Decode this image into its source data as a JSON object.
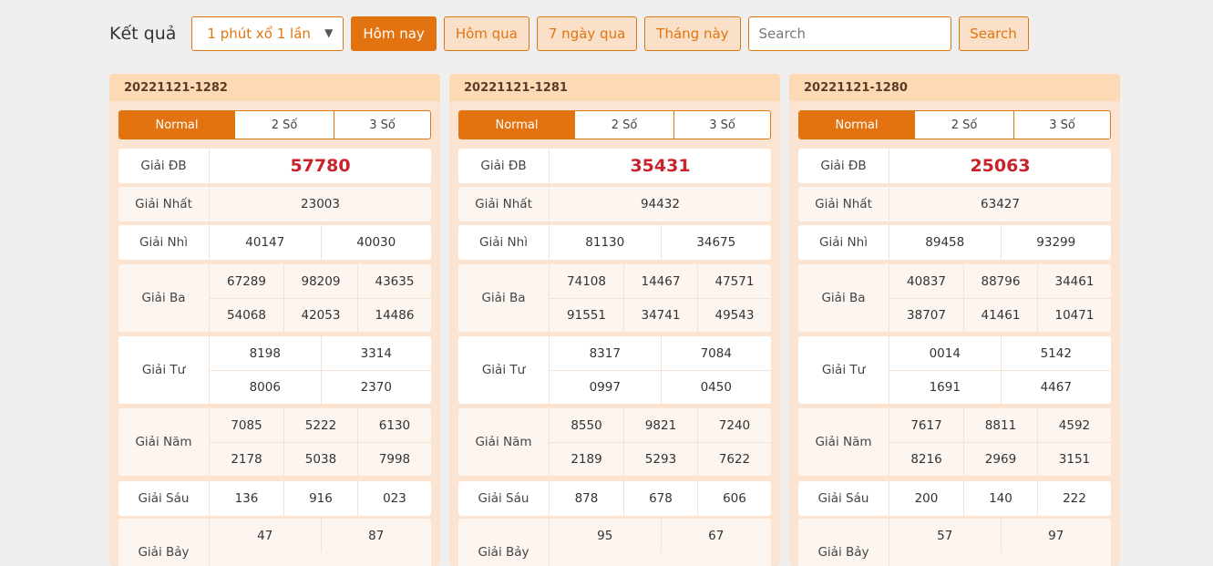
{
  "toolbar": {
    "label": "Kết quả",
    "select_value": "1 phút xổ 1 lần",
    "buttons": [
      "Hôm nay",
      "Hôm qua",
      "7 ngày qua",
      "Tháng này"
    ],
    "active_button": 0,
    "search_placeholder": "Search",
    "search_button": "Search"
  },
  "prize_labels": [
    "Giải ĐB",
    "Giải Nhất",
    "Giải Nhì",
    "Giải Ba",
    "Giải Tư",
    "Giải Năm",
    "Giải Sáu",
    "Giải Bảy"
  ],
  "tab_labels": [
    "Normal",
    "2 Số",
    "3 Số"
  ],
  "results": [
    {
      "id": "20221121-1282",
      "prizes": [
        [
          "57780"
        ],
        [
          "23003"
        ],
        [
          "40147",
          "40030"
        ],
        [
          "67289",
          "98209",
          "43635",
          "54068",
          "42053",
          "14486"
        ],
        [
          "8198",
          "3314",
          "8006",
          "2370"
        ],
        [
          "7085",
          "5222",
          "6130",
          "2178",
          "5038",
          "7998"
        ],
        [
          "136",
          "916",
          "023"
        ],
        [
          "47",
          "87"
        ]
      ]
    },
    {
      "id": "20221121-1281",
      "prizes": [
        [
          "35431"
        ],
        [
          "94432"
        ],
        [
          "81130",
          "34675"
        ],
        [
          "74108",
          "14467",
          "47571",
          "91551",
          "34741",
          "49543"
        ],
        [
          "8317",
          "7084",
          "0997",
          "0450"
        ],
        [
          "8550",
          "9821",
          "7240",
          "2189",
          "5293",
          "7622"
        ],
        [
          "878",
          "678",
          "606"
        ],
        [
          "95",
          "67"
        ]
      ]
    },
    {
      "id": "20221121-1280",
      "prizes": [
        [
          "25063"
        ],
        [
          "63427"
        ],
        [
          "89458",
          "93299"
        ],
        [
          "40837",
          "88796",
          "34461",
          "38707",
          "41461",
          "10471"
        ],
        [
          "0014",
          "5142",
          "1691",
          "4467"
        ],
        [
          "7617",
          "8811",
          "4592",
          "8216",
          "2969",
          "3151"
        ],
        [
          "200",
          "140",
          "222"
        ],
        [
          "57",
          "97"
        ]
      ]
    }
  ],
  "colors": {
    "accent": "#e37311",
    "special_prize": "#c8222b",
    "card_bg": "#fbe4d2",
    "card_header": "#fdd9b5"
  }
}
